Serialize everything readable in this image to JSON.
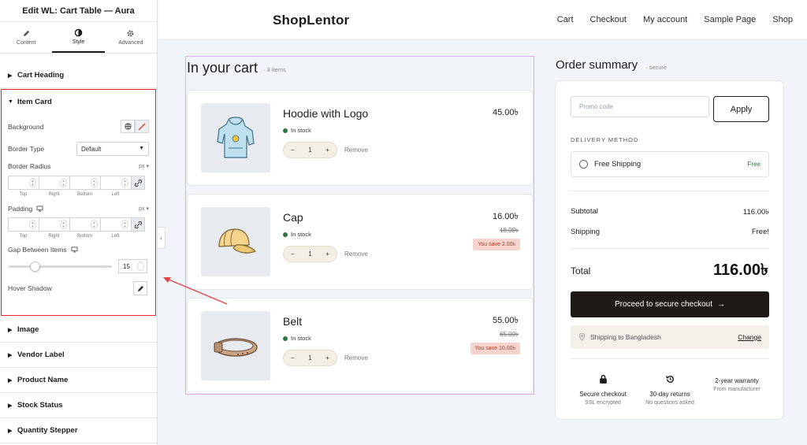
{
  "panel": {
    "title": "Edit WL: Cart Table — Aura",
    "tabs": [
      {
        "label": "Content",
        "icon": "pencil-icon"
      },
      {
        "label": "Style",
        "icon": "contrast-icon"
      },
      {
        "label": "Advanced",
        "icon": "gear-icon"
      }
    ],
    "active_tab": "Style",
    "sections_top": [
      "Cart Heading"
    ],
    "item_card": {
      "heading": "Item Card",
      "background_label": "Background",
      "border_type_label": "Border Type",
      "border_type_value": "Default",
      "border_radius_label": "Border Radius",
      "unit": "px",
      "dim_labels": [
        "Top",
        "Right",
        "Bottom",
        "Left"
      ],
      "padding_label": "Padding",
      "gap_label": "Gap Between Items",
      "gap_value": "15",
      "hover_shadow_label": "Hover Shadow"
    },
    "sections_bottom": [
      "Image",
      "Vendor Label",
      "Product Name",
      "Stock Status",
      "Quantity Stepper"
    ]
  },
  "site": {
    "brand": "ShopLentor",
    "nav": [
      "Cart",
      "Checkout",
      "My account",
      "Sample Page",
      "Shop"
    ]
  },
  "cart": {
    "heading": "In your cart",
    "count": "· 3 items",
    "stock_label": "In stock",
    "remove_label": "Remove",
    "items": [
      {
        "name": "Hoodie with Logo",
        "qty": "1",
        "price": "45.00৳",
        "old_price": "",
        "save": ""
      },
      {
        "name": "Cap",
        "qty": "1",
        "price": "16.00৳",
        "old_price": "18.00৳",
        "save": "You save 2.00৳"
      },
      {
        "name": "Belt",
        "qty": "1",
        "price": "55.00৳",
        "old_price": "65.00৳",
        "save": "You save 10.00৳"
      }
    ]
  },
  "summary": {
    "heading": "Order summary",
    "secure": "· secure",
    "promo_placeholder": "Promo code",
    "apply": "Apply",
    "delivery_label": "DELIVERY METHOD",
    "shipping_option": "Free Shipping",
    "shipping_option_price": "Free",
    "subtotal_label": "Subtotal",
    "subtotal_value": "116.00৳",
    "shipping_label": "Shipping",
    "shipping_value": "Free!",
    "total_label": "Total",
    "total_value": "116.00৳",
    "checkout": "Proceed to secure checkout",
    "ship_to": "Shipping to Bangladesh",
    "change": "Change",
    "trust": [
      {
        "title": "Secure checkout",
        "sub": "SSL encrypted",
        "icon": "lock-icon"
      },
      {
        "title": "30-day returns",
        "sub": "No questions asked",
        "icon": "return-icon"
      },
      {
        "title": "2-year warranty",
        "sub": "From manufacturer",
        "icon": ""
      }
    ]
  },
  "colors": {
    "highlight_border": "#e8202a",
    "arrow": "#e8454b",
    "cart_outline": "#e3a9ee",
    "checkout_btn": "#1e1a16",
    "save_badge": "#f6d4cc"
  }
}
